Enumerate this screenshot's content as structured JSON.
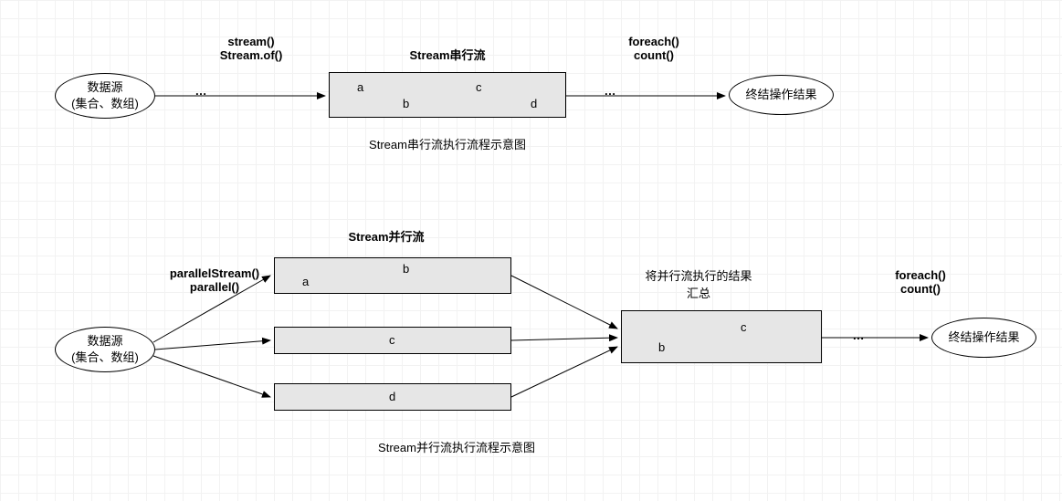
{
  "serial": {
    "source": {
      "l1": "数据源",
      "l2": "(集合、数组)"
    },
    "methods": {
      "l1": "stream()",
      "l2": "Stream.of()"
    },
    "title": "Stream串行流",
    "tokens": {
      "a": "a",
      "b": "b",
      "c": "c",
      "d": "d"
    },
    "terminal": {
      "l1": "foreach()",
      "l2": "count()"
    },
    "result": "终结操作结果",
    "caption": "Stream串行流执行流程示意图",
    "dots1": "…",
    "dots2": "…"
  },
  "parallel": {
    "source": {
      "l1": "数据源",
      "l2": "(集合、数组)"
    },
    "methods": {
      "l1": "parallelStream()",
      "l2": "parallel()"
    },
    "title": "Stream并行流",
    "tokens": {
      "a": "a",
      "b": "b",
      "c": "c",
      "d": "d"
    },
    "merge": {
      "l1": "将并行流执行的结果",
      "l2": "汇总"
    },
    "mergeTokens": {
      "b": "b",
      "c": "c"
    },
    "terminal": {
      "l1": "foreach()",
      "l2": "count()"
    },
    "result": "终结操作结果",
    "caption": "Stream并行流执行流程示意图",
    "dots": "…"
  }
}
